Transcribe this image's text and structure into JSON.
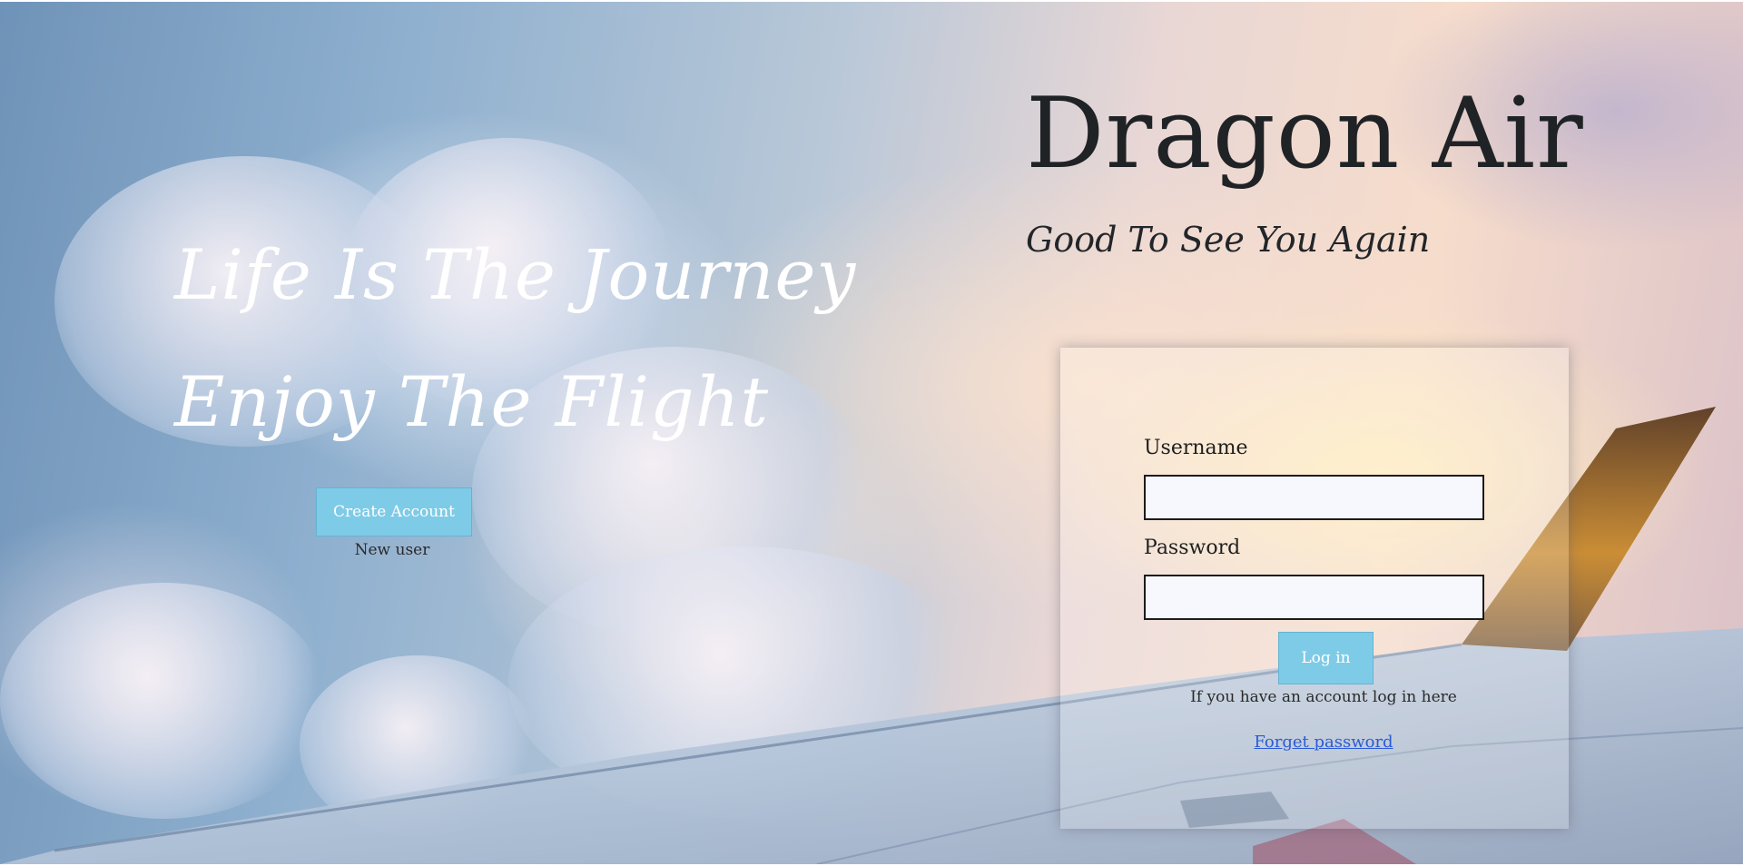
{
  "brand": {
    "title": "Dragon Air"
  },
  "hero": {
    "greeting": "Good To See You Again",
    "tagline_1": "Life Is The Journey",
    "tagline_2": "Enjoy The Flight"
  },
  "signup": {
    "button_label": "Create Account",
    "caption": "New user"
  },
  "login": {
    "username_label": "Username",
    "username_value": "",
    "password_label": "Password",
    "password_value": "",
    "button_label": "Log in",
    "hint": "If you have an account log in here",
    "forgot_link": "Forget password"
  },
  "colors": {
    "button_bg": "#7ecbe7",
    "link": "#2b5bd6",
    "input_bg": "#f7f8fd"
  }
}
